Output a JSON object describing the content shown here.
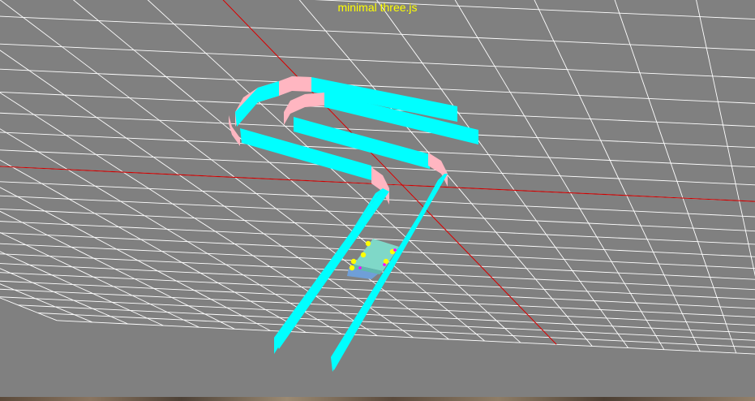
{
  "page": {
    "title": "minimal three.js",
    "title_color": "#ffff00",
    "background_color": "#808080"
  },
  "scene": {
    "grid_color": "#ffffff",
    "axis_color": "#cc0000",
    "straight_wall_color": "#00ffff",
    "curved_wall_color": "#ffb6c1",
    "vehicle_body_color": "#7fd8c8",
    "vehicle_base_color": "#6f9fd8",
    "wheel_color": "#ffff00",
    "wheel_marker_color": "#ff00ff"
  }
}
